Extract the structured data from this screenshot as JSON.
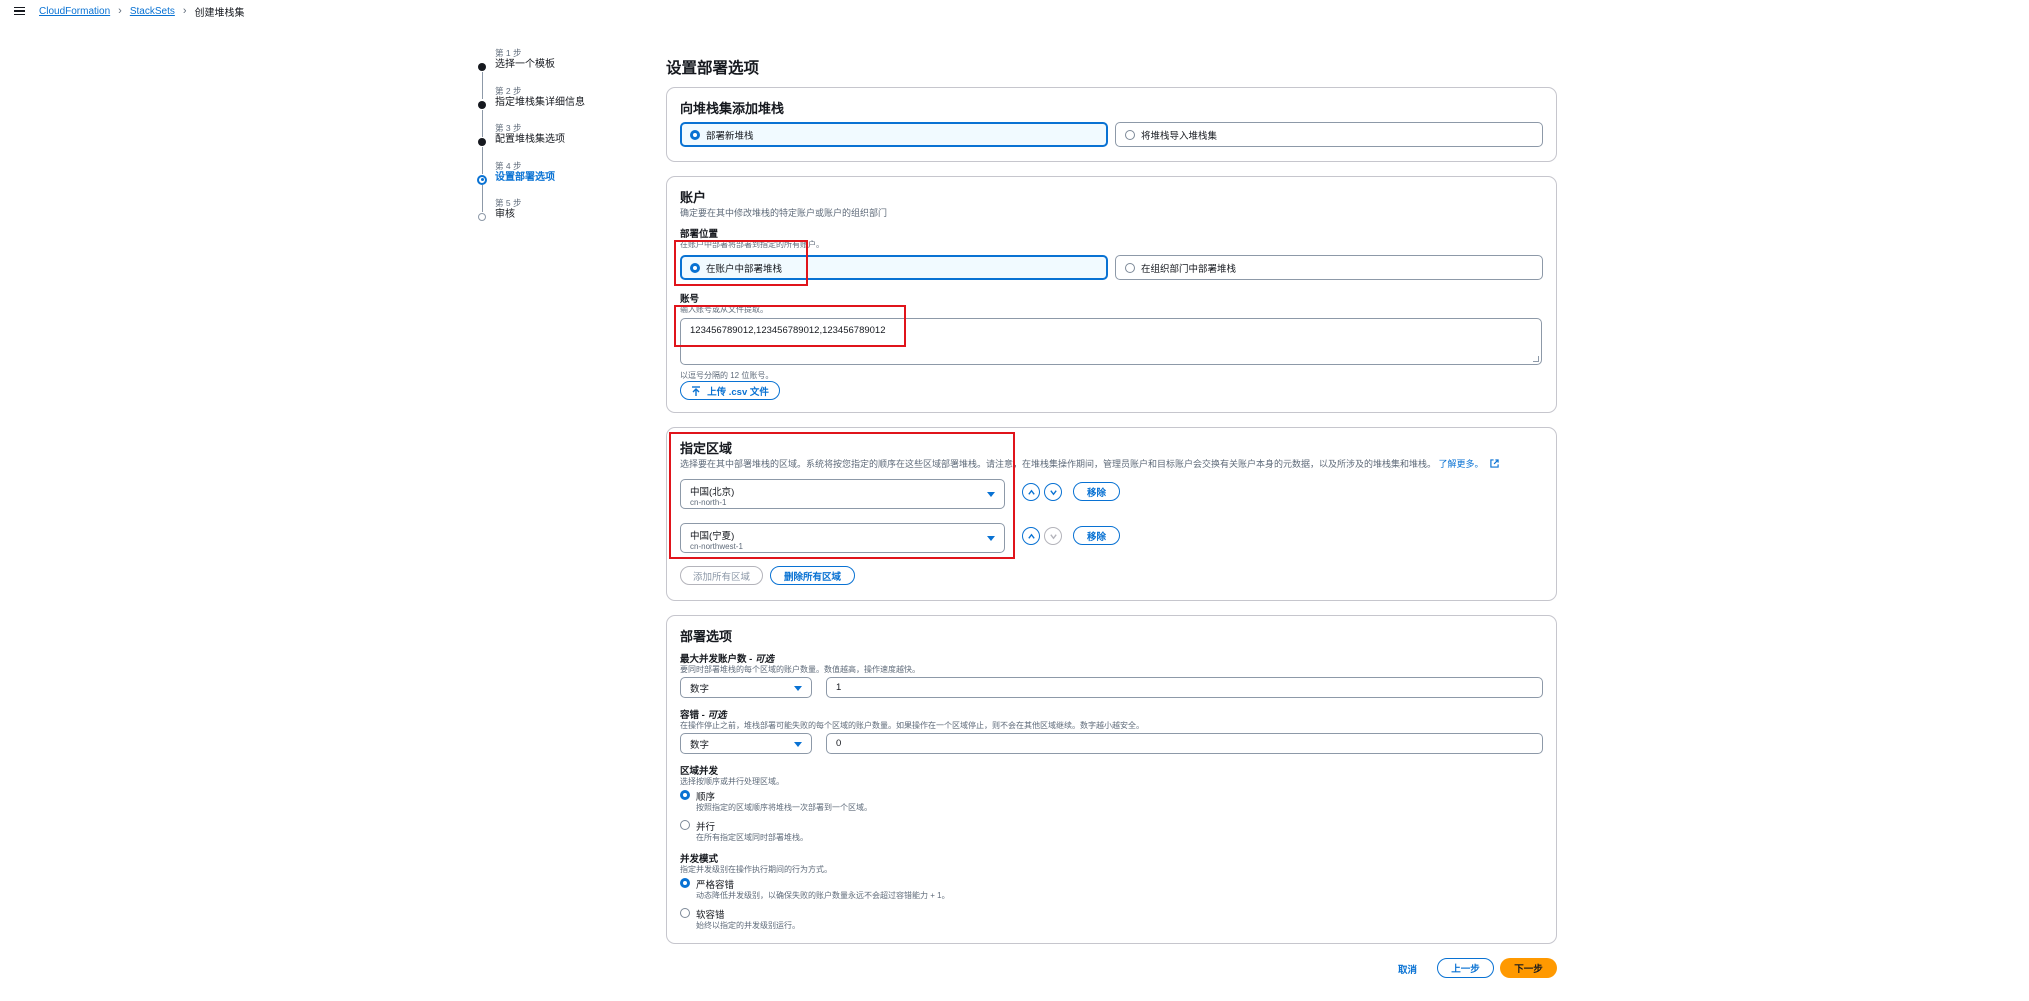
{
  "breadcrumb": {
    "items": [
      "CloudFormation",
      "StackSets"
    ],
    "current": "创建堆栈集"
  },
  "steps": [
    {
      "num": "第 1 步",
      "label": "选择一个模板"
    },
    {
      "num": "第 2 步",
      "label": "指定堆栈集详细信息"
    },
    {
      "num": "第 3 步",
      "label": "配置堆栈集选项"
    },
    {
      "num": "第 4 步",
      "label": "设置部署选项"
    },
    {
      "num": "第 5 步",
      "label": "审核"
    }
  ],
  "page_title": "设置部署选项",
  "add_stacks": {
    "title": "向堆栈集添加堆栈",
    "option_new": "部署新堆栈",
    "option_import": "将堆栈导入堆栈集"
  },
  "accounts": {
    "title": "账户",
    "description": "确定要在其中修改堆栈的特定账户或账户的组织部门",
    "location_label": "部署位置",
    "location_hint": "在账户中部署将部署到指定的所有账户。",
    "option_accounts": "在账户中部署堆栈",
    "option_org": "在组织部门中部署堆栈",
    "number_label": "账号",
    "number_hint": "输入账号或从文件提取。",
    "number_value": "123456789012,123456789012,123456789012",
    "number_footer": "以逗号分隔的 12 位账号。",
    "upload_label": "上传 .csv 文件"
  },
  "regions": {
    "title": "指定区域",
    "description": "选择要在其中部署堆栈的区域。系统将按您指定的顺序在这些区域部署堆栈。请注意，在堆栈集操作期间，管理员账户和目标账户会交换有关账户本身的元数据，以及所涉及的堆栈集和堆栈。",
    "learn_more": "了解更多。",
    "items": [
      {
        "name": "中国(北京)",
        "code": "cn-north-1"
      },
      {
        "name": "中国(宁夏)",
        "code": "cn-northwest-1"
      }
    ],
    "remove_label": "移除",
    "add_all_label": "添加所有区域",
    "remove_all_label": "删除所有区域"
  },
  "deploy_options": {
    "title": "部署选项",
    "max_concurrent_label": "最大并发账户数 - ",
    "max_concurrent_optional": "可选",
    "max_concurrent_hint": "要同时部署堆栈的每个区域的账户数量。数值越高，操作速度越快。",
    "max_concurrent_type": "数字",
    "max_concurrent_value": "1",
    "failure_label": "容错 - ",
    "failure_optional": "可选",
    "failure_hint": "在操作停止之前，堆栈部署可能失败的每个区域的账户数量。如果操作在一个区域停止，则不会在其他区域继续。数字越小越安全。",
    "failure_type": "数字",
    "failure_value": "0",
    "region_conc_label": "区域并发",
    "region_conc_hint": "选择按顺序或并行处理区域。",
    "sequential": "顺序",
    "sequential_hint": "按照指定的区域顺序将堆栈一次部署到一个区域。",
    "parallel": "并行",
    "parallel_hint": "在所有指定区域同时部署堆栈。",
    "conc_mode_label": "并发模式",
    "conc_mode_hint": "指定并发级别在操作执行期间的行为方式。",
    "strict": "严格容错",
    "strict_hint": "动态降低并发级别，以确保失败的账户数量永远不会超过容错能力 + 1。",
    "soft": "软容错",
    "soft_hint": "始终以指定的并发级别运行。"
  },
  "footer": {
    "cancel": "取消",
    "previous": "上一步",
    "next": "下一步"
  },
  "colors": {
    "accent": "#0972d3",
    "primary_button": "#ff9900",
    "highlight": "#e0141b"
  }
}
